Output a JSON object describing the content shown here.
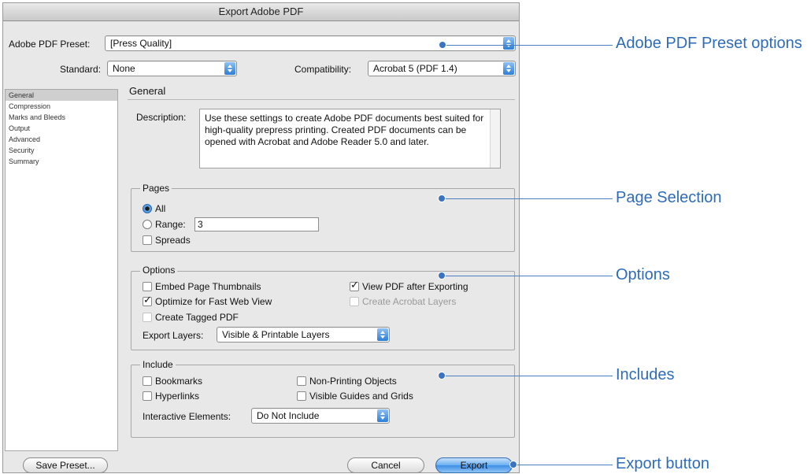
{
  "dialog": {
    "title": "Export Adobe PDF",
    "preset_label": "Adobe PDF Preset:",
    "preset_value": "[Press Quality]",
    "standard_label": "Standard:",
    "standard_value": "None",
    "compat_label": "Compatibility:",
    "compat_value": "Acrobat 5 (PDF 1.4)"
  },
  "sidebar": {
    "items": [
      {
        "label": "General"
      },
      {
        "label": "Compression"
      },
      {
        "label": "Marks and Bleeds"
      },
      {
        "label": "Output"
      },
      {
        "label": "Advanced"
      },
      {
        "label": "Security"
      },
      {
        "label": "Summary"
      }
    ],
    "selected": "General"
  },
  "general": {
    "title": "General",
    "description_label": "Description:",
    "description_text": "Use these settings to create Adobe PDF documents best suited for high-quality prepress printing.  Created PDF documents can be opened with Acrobat and Adobe Reader 5.0 and later."
  },
  "pages": {
    "title": "Pages",
    "all_label": "All",
    "range_label": "Range:",
    "range_value": "3",
    "spreads_label": "Spreads"
  },
  "options": {
    "title": "Options",
    "embed_thumbnails": "Embed Page Thumbnails",
    "optimize_web": "Optimize for Fast Web View",
    "create_tagged": "Create Tagged PDF",
    "view_after": "View PDF after Exporting",
    "create_layers": "Create Acrobat Layers",
    "export_layers_label": "Export Layers:",
    "export_layers_value": "Visible & Printable Layers"
  },
  "include": {
    "title": "Include",
    "bookmarks": "Bookmarks",
    "hyperlinks": "Hyperlinks",
    "non_printing": "Non-Printing Objects",
    "visible_guides": "Visible Guides and Grids",
    "interactive_label": "Interactive Elements:",
    "interactive_value": "Do Not Include"
  },
  "buttons": {
    "save_preset": "Save Preset...",
    "cancel": "Cancel",
    "export": "Export"
  },
  "callouts": {
    "preset": "Adobe PDF Preset options",
    "pages": "Page Selection",
    "options": "Options",
    "includes": "Includes",
    "export": "Export button"
  },
  "colors": {
    "callout": "#2f6cb8",
    "accent_button": "#3d8ee6"
  }
}
